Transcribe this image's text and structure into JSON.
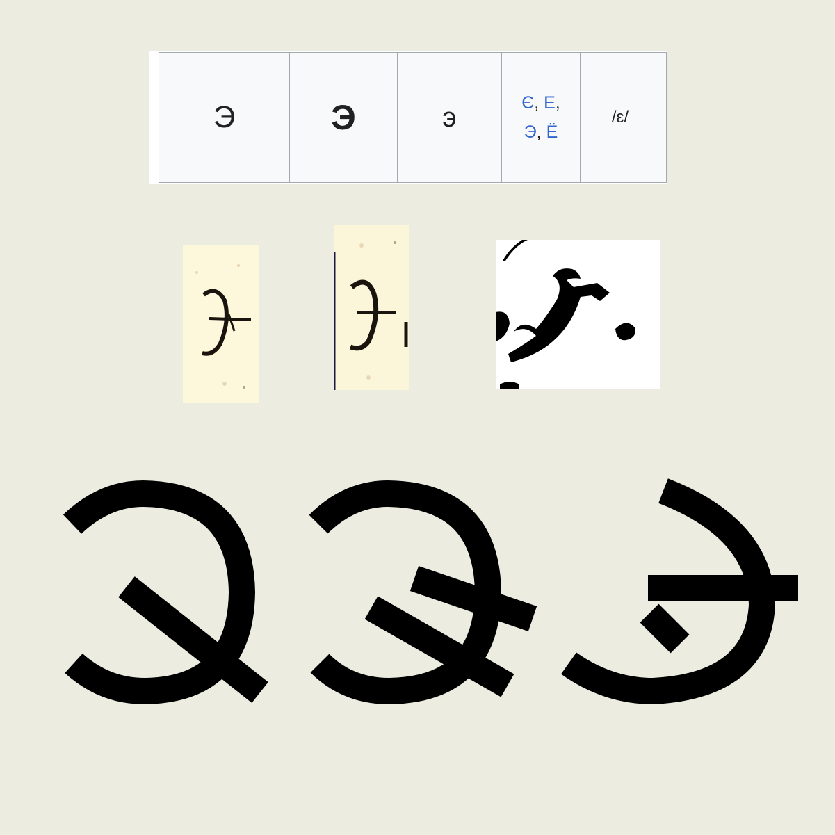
{
  "table": {
    "cells": [
      {
        "name": "uppercase-form",
        "text": "Э"
      },
      {
        "name": "bold-form",
        "text": "Э"
      },
      {
        "name": "lowercase-form",
        "text": "э"
      },
      {
        "name": "related-letters",
        "links": [
          "Є",
          "Е",
          "Э",
          "Ё"
        ]
      },
      {
        "name": "pronunciation",
        "text": "/ɛ/"
      }
    ]
  },
  "colors": {
    "background": "#ecede0",
    "table_cell": "#f8f9fa",
    "table_border": "#a2a9b1",
    "link": "#3366cc",
    "text": "#202122",
    "glyph": "#000000"
  },
  "icons": [
    "scan-glyph-icon",
    "large-glyph-icon"
  ]
}
